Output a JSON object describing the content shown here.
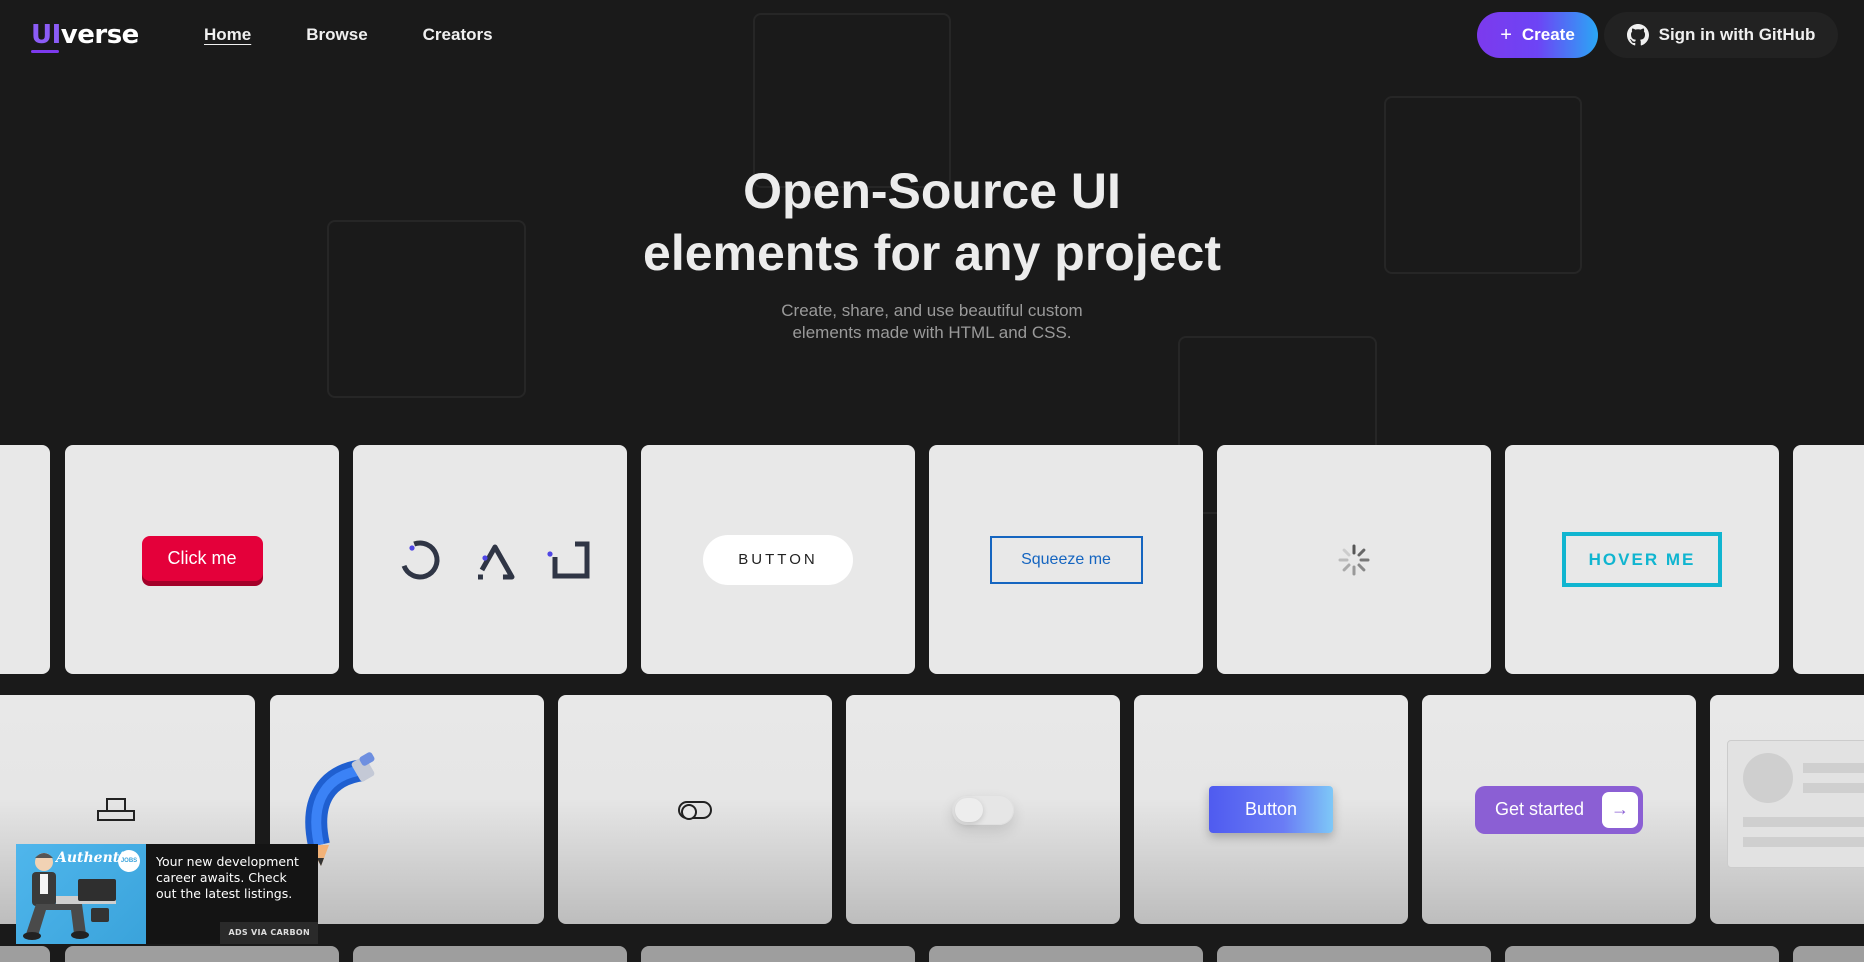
{
  "header": {
    "logo_ui": "UI",
    "logo_rest": "verse",
    "nav": [
      {
        "label": "Home",
        "active": true
      },
      {
        "label": "Browse",
        "active": false
      },
      {
        "label": "Creators",
        "active": false
      }
    ],
    "create_label": "Create",
    "github_label": "Sign in with GitHub"
  },
  "hero": {
    "title_line1": "Open-Source UI",
    "title_line2": "elements for any project",
    "subtitle_line1": "Create, share, and use beautiful custom",
    "subtitle_line2": "elements made with HTML and CSS."
  },
  "cards": {
    "click_me": "Click me",
    "pill_button": "BUTTON",
    "squeeze": "Squeeze me",
    "hover_me": "HOVER ME",
    "gradient_button": "Button",
    "get_started": "Get started"
  },
  "ad": {
    "brand": "Authentic",
    "badge": "JOBS",
    "text": "Your new development career awaits. Check out the latest listings.",
    "via": "ADS VIA CARBON"
  },
  "colors": {
    "background": "#1a1a1a",
    "card": "#e8e8e8",
    "accent_purple": "#7c3aed",
    "accent_blue": "#2aa7f5",
    "click_me_red": "#e4003a",
    "squeeze_blue": "#1565c0",
    "hover_cyan": "#10b5d0",
    "loader_dot": "#4f46e5"
  }
}
